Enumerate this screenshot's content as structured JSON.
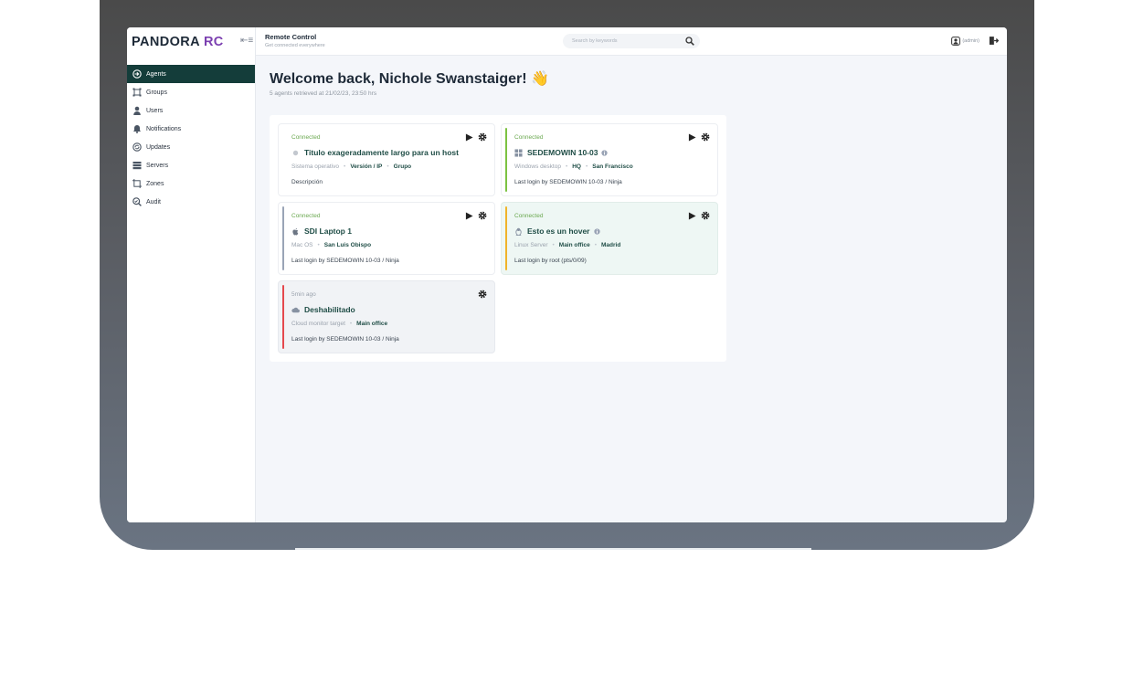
{
  "brand": {
    "name": "PANDORA",
    "suffix": "RC"
  },
  "header": {
    "title": "Remote Control",
    "subtitle": "Get connected everywhere",
    "search_placeholder": "Search by keywords",
    "user_label": "(admin)"
  },
  "sidebar": {
    "items": [
      {
        "label": "Agents",
        "icon": "agents-icon",
        "active": true
      },
      {
        "label": "Groups",
        "icon": "groups-icon"
      },
      {
        "label": "Users",
        "icon": "user-icon"
      },
      {
        "label": "Notifications",
        "icon": "bell-icon"
      },
      {
        "label": "Updates",
        "icon": "updates-icon"
      },
      {
        "label": "Servers",
        "icon": "servers-icon"
      },
      {
        "label": "Zones",
        "icon": "zones-icon"
      },
      {
        "label": "Audit",
        "icon": "audit-icon"
      }
    ]
  },
  "main": {
    "welcome": "Welcome back, Nichole Swanstaiger! 👋",
    "retrieved": "5 agents retrieved at 21/02/23, 23:50 hrs"
  },
  "cards": [
    {
      "status": "Connected",
      "title": "Titulo exageradamente largo para un host",
      "os": "Sistema operativo",
      "meta1": "Versión / IP",
      "meta2": "Grupo",
      "footer": "Descripción",
      "accent": "#ffffff",
      "icon": "generic-os-icon"
    },
    {
      "status": "Connected",
      "title": "SEDEMOWIN 10-03",
      "os": "Windows desktop",
      "meta1": "HQ",
      "meta2": "San Francisco",
      "footer": "Last login by SEDEMOWIN 10-03 / Ninja",
      "accent": "#7cc242",
      "icon": "windows-icon"
    },
    {
      "status": "Connected",
      "title": "SDI Laptop 1",
      "os": "Mac OS",
      "meta1": "San Luis Obispo",
      "footer": "Last login by SEDEMOWIN 10-03 / Ninja",
      "accent": "#9aa4b6",
      "icon": "apple-icon"
    },
    {
      "status": "Connected",
      "title": "Esto es un hover",
      "os": "Linux Server",
      "meta1": "Main office",
      "meta2": "Madrid",
      "footer": "Last login by root (pts/0/09)",
      "accent": "#f0b429",
      "icon": "linux-icon"
    },
    {
      "status": "5min ago",
      "title": "Deshabilitado",
      "os": "Cloud monitor target",
      "meta1": "Main office",
      "footer": "Last login by SEDEMOWIN 10-03 / Ninja",
      "accent": "#e5484d",
      "icon": "cloud-icon"
    }
  ]
}
